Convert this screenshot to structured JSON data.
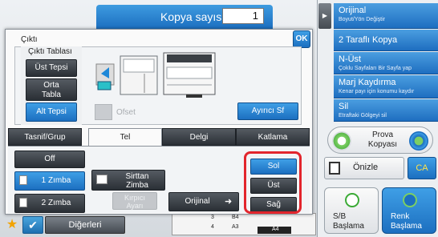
{
  "header": {
    "copies_label": "Kopya sayısı",
    "copies_value": "1"
  },
  "dialog": {
    "title": "Çıktı",
    "ok_label": "OK",
    "output_tray": {
      "title": "Çıktı Tablası",
      "items": [
        "Üst Tepsi",
        "Orta\nTabla",
        "Alt Tepsi"
      ],
      "selected": "Alt Tepsi"
    },
    "offset_label": "Ofset",
    "separator_label": "Ayırıcı Sf",
    "tabs": [
      "Tasnif/Grup",
      "Tel",
      "Delgi",
      "Katlama"
    ],
    "active_tab": "Tel",
    "staple": {
      "off": "Off",
      "one": "1 Zımba",
      "two": "2 Zımba",
      "saddle": "Sirttan\nZimba",
      "crease": "Kırpıcı\nAyarı",
      "original": "Orijinal",
      "positions": [
        "Sol",
        "Üst",
        "Sağ"
      ],
      "selected_position": "Sol"
    }
  },
  "right_panel": {
    "menu": [
      {
        "title": "Orijinal",
        "subtitle": "Boyut/Yön Değiştir"
      },
      {
        "title": "2 Taraflı Kopya",
        "subtitle": ""
      },
      {
        "title": "N-Üst",
        "subtitle": "Çoklu Sayfaları Bir Sayfa yap"
      },
      {
        "title": "Marj Kaydırma",
        "subtitle": "Kenar payı için konumu kaydır"
      },
      {
        "title": "Sil",
        "subtitle": "Etraftaki Gölgeyi sil"
      }
    ],
    "preview_copy": "Prova\nKopyası",
    "preview": "Önizle",
    "ca": "CA",
    "bw_start": "S/B\nBaşlama",
    "color_start": "Renk\nBaşlama"
  },
  "footer": {
    "others": "Diğerleri",
    "trays": [
      "3",
      "B4",
      "4",
      "A3",
      "A4"
    ]
  },
  "colors": {
    "accent": "#1c6fc0",
    "highlight": "#e2252c",
    "start_green": "#3aaa35"
  }
}
